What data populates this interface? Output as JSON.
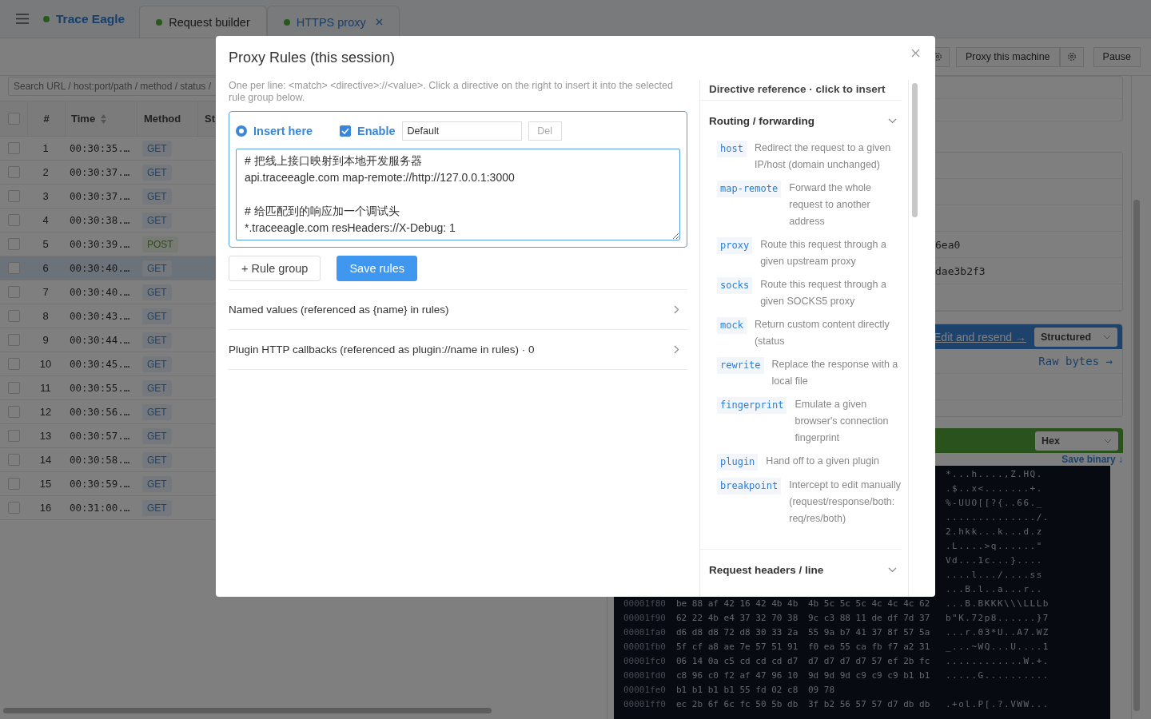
{
  "app": {
    "brand": "Trace Eagle",
    "tabs": [
      {
        "label": "Request builder",
        "selected": false
      },
      {
        "label": "HTTPS proxy",
        "selected": true
      }
    ]
  },
  "toolbar": {
    "buttons": [
      {
        "kind": "icon"
      },
      {
        "kind": "text",
        "label": "Proxy this machine"
      },
      {
        "kind": "icon"
      },
      {
        "kind": "text",
        "label": "Pause"
      }
    ]
  },
  "search": {
    "placeholder": "Search URL / host:port/path / method / status /"
  },
  "table": {
    "all_checked": false,
    "columns": [
      "#",
      "Time",
      "Method",
      "St"
    ],
    "rows": [
      {
        "n": "1",
        "time": "00:30:35.…",
        "method": "GET",
        "kind": "get",
        "selected": false,
        "checked": false
      },
      {
        "n": "2",
        "time": "00:30:37.…",
        "method": "GET",
        "kind": "get",
        "selected": false,
        "checked": false
      },
      {
        "n": "3",
        "time": "00:30:37.…",
        "method": "GET",
        "kind": "get",
        "selected": false,
        "checked": false
      },
      {
        "n": "4",
        "time": "00:30:38.…",
        "method": "GET",
        "kind": "get",
        "selected": false,
        "checked": false
      },
      {
        "n": "5",
        "time": "00:30:39.…",
        "method": "POST",
        "kind": "post",
        "selected": false,
        "checked": false
      },
      {
        "n": "6",
        "time": "00:30:40.…",
        "method": "GET",
        "kind": "get",
        "selected": true,
        "checked": false
      },
      {
        "n": "7",
        "time": "00:30:40.…",
        "method": "GET",
        "kind": "get",
        "selected": false,
        "checked": false
      },
      {
        "n": "8",
        "time": "00:30:43.…",
        "method": "GET",
        "kind": "get",
        "selected": false,
        "checked": false
      },
      {
        "n": "9",
        "time": "00:30:44.…",
        "method": "GET",
        "kind": "get",
        "selected": false,
        "checked": false
      },
      {
        "n": "10",
        "time": "00:30:45.…",
        "method": "GET",
        "kind": "get",
        "selected": false,
        "checked": false
      },
      {
        "n": "11",
        "time": "00:30:55.…",
        "method": "GET",
        "kind": "get",
        "selected": false,
        "checked": false
      },
      {
        "n": "12",
        "time": "00:30:56.…",
        "method": "GET",
        "kind": "get",
        "selected": false,
        "checked": false
      },
      {
        "n": "13",
        "time": "00:30:57.…",
        "method": "GET",
        "kind": "get",
        "selected": false,
        "checked": false
      },
      {
        "n": "14",
        "time": "00:30:58.…",
        "method": "GET",
        "kind": "get",
        "selected": false,
        "checked": false
      },
      {
        "n": "15",
        "time": "00:30:59.…",
        "method": "GET",
        "kind": "get",
        "selected": false,
        "checked": false
      },
      {
        "n": "16",
        "time": "00:31:00.…",
        "method": "GET",
        "kind": "get",
        "selected": false,
        "checked": false
      }
    ]
  },
  "details": {
    "values": [
      "6ea0",
      "dae3b2f3"
    ],
    "request_bar": {
      "link": "Edit and resend →",
      "view": "Structured"
    },
    "raw_link": "Raw bytes →",
    "response_bar": {
      "view": "Hex"
    },
    "save_link": "Save binary ↓",
    "hex_rows": [
      {
        "ascii": "*...h....,Z.HQ."
      },
      {
        "ascii": ".$..x<.......+."
      },
      {
        "ascii": "%-UUO[[?{..66._"
      },
      {
        "ascii": "............../."
      },
      {
        "ascii": "2.hkk...k...d.z"
      },
      {
        "ascii": ".L....>q......\""
      },
      {
        "ascii": "Vd...1c...}...."
      },
      {
        "ascii": "....l.../....ss"
      },
      {
        "ascii": "...B.l..a...r.."
      },
      {
        "offset": "00001f80",
        "hex1": "be 88 af 42 16 42 4b 4b",
        "hex2": "4b 5c 5c 5c 4c 4c 4c 62",
        "ascii": "...B.BKKK\\\\\\LLLb"
      },
      {
        "offset": "00001f90",
        "hex1": "62 22 4b e4 37 32 70 38",
        "hex2": "9c c3 88 11 de df 7d 37",
        "ascii": "b\"K.72p8......}7"
      },
      {
        "offset": "00001fa0",
        "hex1": "d6 d8 d8 72 d8 30 33 2a",
        "hex2": "55 9a b7 41 37 8f 57 5a",
        "ascii": "...r.03*U..A7.WZ"
      },
      {
        "offset": "00001fb0",
        "hex1": "5f cf a8 ae 7e 57 51 91",
        "hex2": "f0 ea 55 ca fb f7 a2 31",
        "ascii": "_...~WQ...U....1"
      },
      {
        "offset": "00001fc0",
        "hex1": "06 14 0a c5 cd cd cd d7",
        "hex2": "d7 d7 d7 d7 57 ef 2b fc",
        "ascii": "............W.+."
      },
      {
        "offset": "00001fd0",
        "hex1": "c8 96 c0 f2 af 47 96 10",
        "hex2": "9d 9d 9d c9 c9 c9 b1 b1",
        "ascii": ".....G.........."
      },
      {
        "offset": "00001fe0",
        "hex1": "b1 b1 b1 b1 55 fd 02 c8",
        "hex2": "09 78"
      },
      {
        "offset": "00001ff0",
        "hex1": "ec 2b 6f 6c fc 50 5b db",
        "hex2": "3f b2 56 57 57 d7 db db",
        "ascii": ".+ol.P[.?.VWW..."
      }
    ]
  },
  "modal": {
    "title": "Proxy Rules (this session)",
    "hint": "One per line: <match> <directive>://<value>. Click a directive on the right to insert it into the selected rule group below.",
    "group": {
      "radio_label": "Insert here",
      "selected": true,
      "enable_label": "Enable",
      "enabled": true,
      "name": "Default",
      "delete": "Del",
      "delete_disabled": true,
      "rules": "# 把线上接口映射到本地开发服务器\napi.traceeagle.com map-remote://http://127.0.0.1:3000\n\n# 给匹配到的响应加一个调试头\n*.traceeagle.com resHeaders://X-Debug: 1"
    },
    "buttons": [
      {
        "label": "+ Rule group",
        "kind": "secondary"
      },
      {
        "label": "Save rules",
        "kind": "primary"
      }
    ],
    "panels": [
      {
        "title": "Named values (referenced as {name} in rules)"
      },
      {
        "title": "Plugin HTTP callbacks (referenced as plugin://name in rules) · 0"
      }
    ],
    "reference": {
      "title": "Directive reference · click to insert",
      "sections": [
        {
          "title": "Routing / forwarding",
          "items": [
            {
              "tag": "host",
              "desc": "Redirect the request to a given IP/host (domain unchanged)"
            },
            {
              "tag": "map-remote",
              "desc": "Forward the whole request to another address"
            },
            {
              "tag": "proxy",
              "desc": "Route this request through a given upstream proxy"
            },
            {
              "tag": "socks",
              "desc": "Route this request through a given SOCKS5 proxy"
            },
            {
              "tag": "mock",
              "desc": "Return custom content directly (status"
            },
            {
              "tag": "rewrite",
              "desc": "Replace the response with a local file"
            },
            {
              "tag": "fingerprint",
              "desc": "Emulate a given browser's connection fingerprint"
            },
            {
              "tag": "plugin",
              "desc": "Hand off to a given plugin"
            },
            {
              "tag": "breakpoint",
              "desc": "Intercept to edit manually (request/response/both: req/res/both)"
            }
          ]
        },
        {
          "title": "Request headers / line"
        }
      ]
    }
  }
}
